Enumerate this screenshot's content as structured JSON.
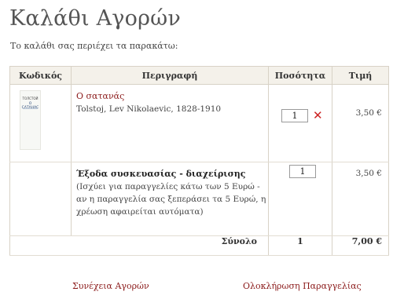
{
  "page": {
    "title": "Καλάθι Αγορών",
    "intro": "Το καλάθι σας περιέχει τα παρακάτω:"
  },
  "table": {
    "headers": [
      "Κωδικός",
      "Περιγραφή",
      "Ποσότητα",
      "Τιμή"
    ]
  },
  "items": [
    {
      "cover_author": "ТОЛСТОЙ",
      "cover_title": "О САТАНАС",
      "title": "Ο σατανάς",
      "author": "Tolstoj, Lev Nikolaevic, 1828-1910",
      "quantity": "1",
      "price": "3,50 €",
      "remove_icon": "close-icon"
    }
  ],
  "packaging": {
    "title": "Έξοδα συσκευασίας - διαχείρισης",
    "note": "(Ισχύει για παραγγελίες κάτω των 5 Ευρώ - αν η παραγγελία σας ξεπεράσει τα 5 Ευρώ, η χρέωση αφαιρείται αυτόματα)",
    "quantity": "1",
    "price": "3,50 €"
  },
  "totals": {
    "label": "Σύνολο",
    "count": "1",
    "price": "7,00 €"
  },
  "actions": {
    "continue": "Συνέχεια Αγορών",
    "checkout": "Ολοκλήρωση Παραγγελίας"
  },
  "colors": {
    "link": "#8b1a1a",
    "header_bg": "#f4f1ea",
    "remove": "#cc2222"
  }
}
